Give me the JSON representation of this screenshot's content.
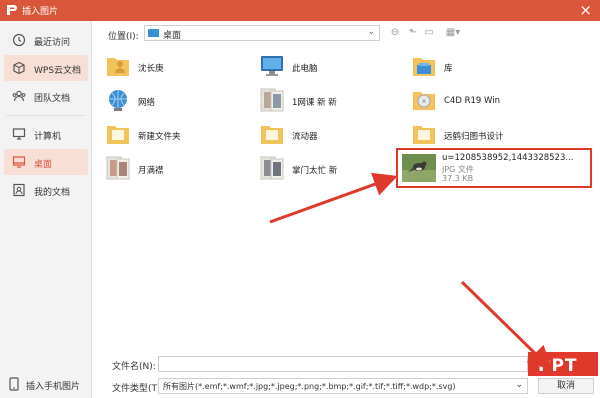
{
  "window": {
    "title": "插入图片",
    "brand_color": "#d9563a"
  },
  "sidebar": {
    "items": [
      {
        "label": "最近访问",
        "icon": "clock-icon"
      },
      {
        "label": "WPS云文档",
        "icon": "cloud-box-icon"
      },
      {
        "label": "团队文档",
        "icon": "team-icon"
      },
      {
        "label": "计算机",
        "icon": "computer-icon"
      },
      {
        "label": "桌面",
        "icon": "desktop-icon"
      },
      {
        "label": "我的文档",
        "icon": "my-documents-icon"
      }
    ],
    "active_index": 4,
    "bottom": {
      "label": "插入手机图片",
      "icon": "phone-icon"
    }
  },
  "toolbar": {
    "location_label": "位置(I):",
    "location_value": "桌面"
  },
  "files": [
    {
      "name": "沈长庚",
      "kind": "user-folder"
    },
    {
      "name": "此电脑",
      "kind": "computer"
    },
    {
      "name": "库",
      "kind": "library"
    },
    {
      "name": "网络",
      "kind": "network"
    },
    {
      "name": "1网课    新    新",
      "kind": "image-folder"
    },
    {
      "name": "C4D R19 Win",
      "kind": "cd"
    },
    {
      "name": "新建文件夹",
      "kind": "folder"
    },
    {
      "name": "流动器",
      "kind": "folder"
    },
    {
      "name": "远鹤归图书设计",
      "kind": "folder"
    },
    {
      "name": "月满襟",
      "kind": "image-folder"
    },
    {
      "name": "掌门太忙  新",
      "kind": "image-folder"
    }
  ],
  "selected_file": {
    "name": "u=1208538952,1443328523...",
    "type": "JPG 文件",
    "size": "37.3 KB"
  },
  "footer": {
    "filename_label": "文件名(N):",
    "filename_value": "",
    "filetype_label": "文件类型(T):",
    "filetype_value": "所有图片(*.emf;*.wmf;*.jpg;*.jpeg;*.png;*.bmp;*.gif;*.tif;*.tiff;*.wdp;*.svg)",
    "cancel_label": "取消"
  },
  "watermark_text": "PPT",
  "annotation_color": "#e0392b"
}
